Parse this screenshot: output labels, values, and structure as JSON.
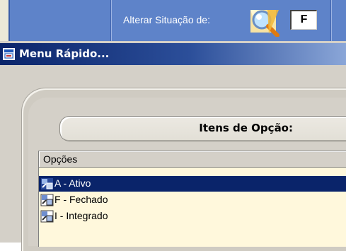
{
  "toolbar": {
    "status_label": "Alterar Situação de:",
    "status_code": "F",
    "search_icon": "magnifier-icon"
  },
  "window": {
    "title": "Menu Rápido...",
    "icon": "app-window-icon"
  },
  "panel": {
    "header": "Itens de Opção:"
  },
  "list": {
    "column_header": "Opções",
    "rows": [
      {
        "label": "A - Ativo",
        "selected": true
      },
      {
        "label": "F - Fechado",
        "selected": false
      },
      {
        "label": "I - Integrado",
        "selected": false
      }
    ]
  },
  "colors": {
    "toolbar_blue": "#5e83c9",
    "titlebar_dark": "#0a246a",
    "selection": "#0a246a",
    "list_bg": "#fff8dc"
  }
}
